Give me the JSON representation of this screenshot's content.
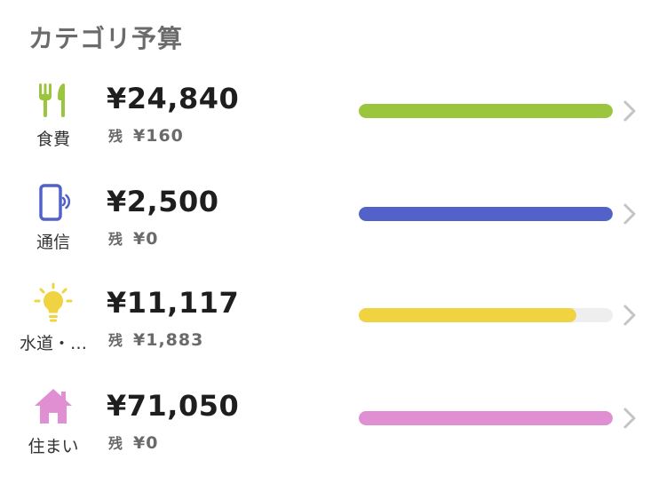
{
  "section": {
    "title": "カテゴリ予算"
  },
  "categories": [
    {
      "name": "食費",
      "icon": "fork-knife-icon",
      "amount": "¥24,840",
      "remaining_label": "残",
      "remaining": "¥160",
      "progress": 1.0,
      "color": "#9BC53D"
    },
    {
      "name": "通信",
      "icon": "smartphone-icon",
      "amount": "¥2,500",
      "remaining_label": "残",
      "remaining": "¥0",
      "progress": 1.0,
      "color": "#5262C8"
    },
    {
      "name": "水道・…",
      "icon": "lightbulb-icon",
      "amount": "¥11,117",
      "remaining_label": "残",
      "remaining": "¥1,883",
      "progress": 0.856,
      "color": "#F0D340"
    },
    {
      "name": "住まい",
      "icon": "house-icon",
      "amount": "¥71,050",
      "remaining_label": "残",
      "remaining": "¥0",
      "progress": 1.0,
      "color": "#E08FD2"
    }
  ],
  "track_color": "#EEEEEE"
}
